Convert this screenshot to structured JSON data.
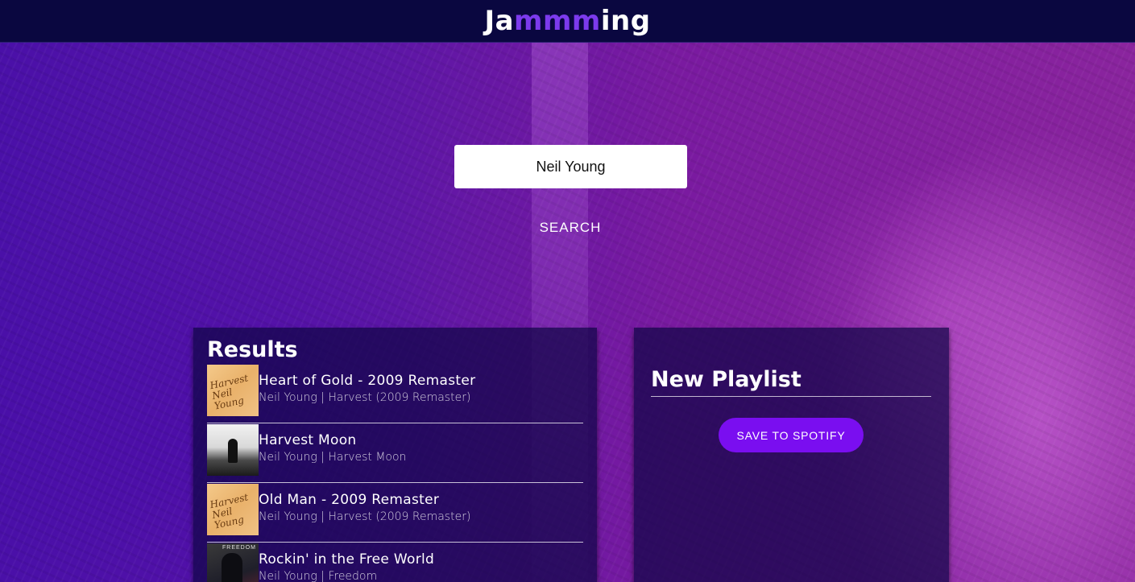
{
  "header": {
    "logo_prefix": "Ja",
    "logo_accent": "mmm",
    "logo_suffix": "ing"
  },
  "search": {
    "value": "Neil Young",
    "button_label": "SEARCH"
  },
  "results": {
    "title": "Results",
    "tracks": [
      {
        "name": "Heart of Gold - 2009 Remaster",
        "meta": "Neil Young | Harvest (2009 Remaster)",
        "art": "harvest"
      },
      {
        "name": "Harvest Moon",
        "meta": "Neil Young | Harvest Moon",
        "art": "moon"
      },
      {
        "name": "Old Man - 2009 Remaster",
        "meta": "Neil Young | Harvest (2009 Remaster)",
        "art": "harvest"
      },
      {
        "name": "Rockin' in the Free World",
        "meta": "Neil Young | Freedom",
        "art": "freedom"
      }
    ]
  },
  "playlist": {
    "name": "New Playlist",
    "save_label": "SAVE TO SPOTIFY"
  },
  "album_art_text": {
    "harvest_line1": "Harvest",
    "harvest_line2": "Neil Young",
    "freedom": "FREEDOM"
  },
  "colors": {
    "header_bg": "#0a0740",
    "accent": "#7c3aed",
    "save_button": "#7a0ef0",
    "panel_bg": "rgba(16, 6, 70, 0.72)"
  }
}
